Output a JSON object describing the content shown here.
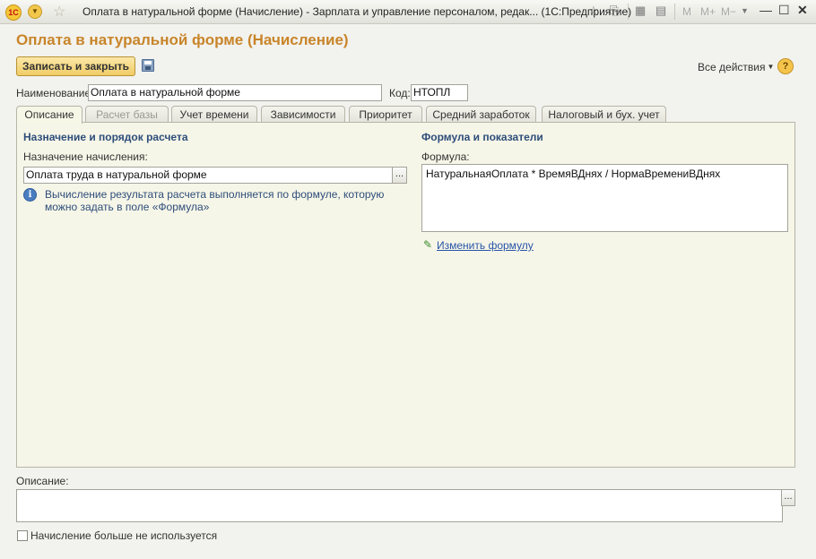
{
  "window": {
    "title": "Оплата в натуральной форме (Начисление) - Зарплата и управление персоналом, редак...  (1С:Предприятие)",
    "logo": "1С",
    "toolbar_m": [
      "M",
      "M+",
      "M−"
    ]
  },
  "form": {
    "title": "Оплата в натуральной форме (Начисление)",
    "save_close_label": "Записать и закрыть",
    "all_actions_label": "Все действия",
    "help_label": "?"
  },
  "fields": {
    "name_label": "Наименование:",
    "name_value": "Оплата в натуральной форме",
    "code_label": "Код:",
    "code_value": "НТОПЛ"
  },
  "tabs": [
    {
      "label": "Описание",
      "active": true,
      "enabled": true
    },
    {
      "label": "Расчет базы",
      "active": false,
      "enabled": false
    },
    {
      "label": "Учет времени",
      "active": false,
      "enabled": true
    },
    {
      "label": "Зависимости",
      "active": false,
      "enabled": true
    },
    {
      "label": "Приоритет",
      "active": false,
      "enabled": true
    },
    {
      "label": "Средний заработок",
      "active": false,
      "enabled": true
    },
    {
      "label": "Налоговый и  бух. учет",
      "active": false,
      "enabled": true
    }
  ],
  "left_section": {
    "title": "Назначение и порядок расчета",
    "purpose_label": "Назначение начисления:",
    "purpose_value": "Оплата труда в натуральной форме",
    "info_text": "Вычисление результата расчета выполняется по формуле, которую можно задать в поле «Формула»"
  },
  "right_section": {
    "title": "Формула и показатели",
    "formula_label": "Формула:",
    "formula_value": "НатуральнаяОплата * ВремяВДнях / НормаВремениВДнях",
    "edit_formula_link": "Изменить формулу"
  },
  "bottom": {
    "description_label": "Описание:",
    "description_value": "",
    "unused_checkbox_label": "Начисление больше не используется",
    "unused_checked": false
  },
  "common": {
    "ellipsis": "..."
  }
}
